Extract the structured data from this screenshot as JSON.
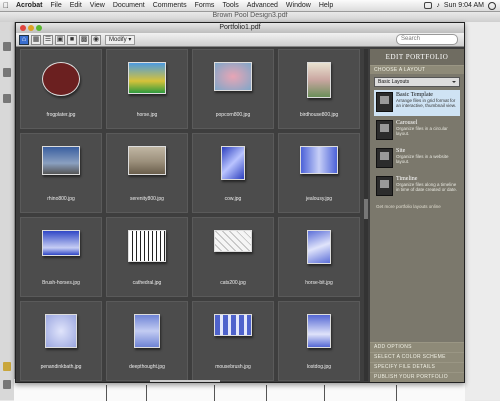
{
  "menubar": {
    "app": "Acrobat",
    "items": [
      "File",
      "Edit",
      "View",
      "Document",
      "Comments",
      "Forms",
      "Tools",
      "Advanced",
      "Window",
      "Help"
    ],
    "clock": "Sun 9:04 AM"
  },
  "back_window": {
    "title": "Brown Pool Design3.pdf"
  },
  "portfolio": {
    "title": "Portfolio1.pdf",
    "modify_label": "Modify",
    "search_placeholder": "Search",
    "files": [
      {
        "name": "frogplater.jpg",
        "thumb_bg": "#6b2020"
      },
      {
        "name": "horse.jpg",
        "thumb_bg": "#d6c23a"
      },
      {
        "name": "popcorn800.jpg",
        "thumb_bg": "#7fa7c9"
      },
      {
        "name": "birdhouse800.jpg",
        "thumb_bg": "#e9e2d0"
      },
      {
        "name": "rhino800.jpg",
        "thumb_bg": "#3a5fa0"
      },
      {
        "name": "serenity800.jpg",
        "thumb_bg": "#9b8f7b"
      },
      {
        "name": "cow.jpg",
        "thumb_bg": "#2c3fbf"
      },
      {
        "name": "jealousy.jpg",
        "thumb_bg": "#4c62d8"
      },
      {
        "name": "Brush-horses.jpg",
        "thumb_bg": "#3047c6"
      },
      {
        "name": "cathedral.jpg",
        "thumb_bg": "#ffffff"
      },
      {
        "name": "cats200.jpg",
        "thumb_bg": "#f5f5f5"
      },
      {
        "name": "horse-bit.jpg",
        "thumb_bg": "#5c6fd8"
      },
      {
        "name": "penandinkbath.jpg",
        "thumb_bg": "#9ba7e0"
      },
      {
        "name": "deepthought.jpg",
        "thumb_bg": "#6f84d6"
      },
      {
        "name": "mousebrush.jpg",
        "thumb_bg": "#4f63cc"
      },
      {
        "name": "lostdog.jpg",
        "thumb_bg": "#5568d4"
      }
    ]
  },
  "panel": {
    "title": "EDIT PORTFOLIO",
    "choose_layout": "CHOOSE A LAYOUT",
    "dropdown_value": "Basic Layouts",
    "layouts": [
      {
        "name": "Basic Template",
        "desc": "Arrange files in grid format for an interactive, thumbnail view.",
        "selected": true
      },
      {
        "name": "Carousel",
        "desc": "Organize files in a circular layout.",
        "selected": false
      },
      {
        "name": "Site",
        "desc": "Organize files in a website layout.",
        "selected": false
      },
      {
        "name": "Timeline",
        "desc": "Organize files along a timeline in time of date created or date.",
        "selected": false
      }
    ],
    "get_more": "Get more portfolio layouts online",
    "bottom_sections": [
      "ADD OPTIONS",
      "SELECT A COLOR SCHEME",
      "SPECIFY FILE DETAILS",
      "PUBLISH YOUR PORTFOLIO"
    ]
  }
}
